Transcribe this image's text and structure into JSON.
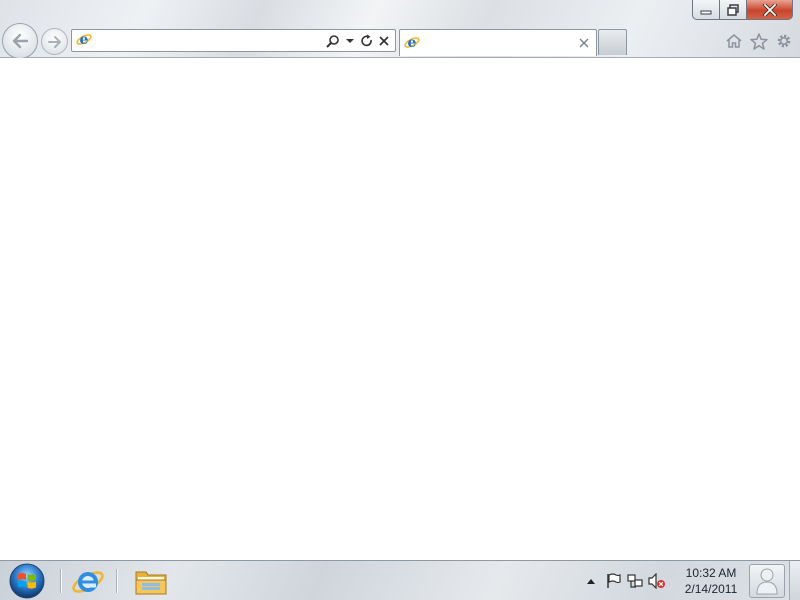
{
  "window": {
    "caption_buttons": [
      {
        "name": "minimize",
        "icon": "minimize-icon"
      },
      {
        "name": "maximize",
        "icon": "restore-icon"
      },
      {
        "name": "close",
        "icon": "close-icon"
      }
    ]
  },
  "navigation": {
    "back_icon": "back-arrow-icon",
    "forward_icon": "forward-arrow-icon"
  },
  "address_bar": {
    "value": "",
    "placeholder": "",
    "icons": [
      "ie-logo-icon",
      "search-icon",
      "dropdown-arrow-icon",
      "refresh-icon",
      "stop-icon"
    ]
  },
  "tabs": [
    {
      "title": "",
      "icon": "ie-logo-icon",
      "active": true
    }
  ],
  "command_icons": [
    "home-icon",
    "favorites-star-icon",
    "tools-gear-icon"
  ],
  "taskbar": {
    "pinned": [
      {
        "name": "internet-explorer",
        "icon": "ie-logo-icon"
      },
      {
        "name": "windows-explorer",
        "icon": "folder-icon"
      }
    ],
    "tray_icons": [
      "show-hidden-icons-arrow",
      "action-center-flag-icon",
      "network-icon",
      "volume-muted-icon"
    ],
    "clock": {
      "time": "10:32 AM",
      "date": "2/14/2011"
    }
  },
  "colors": {
    "close_button": "#c9442b",
    "ie_blue": "#1f6fc7",
    "ie_ring": "#f2b632"
  }
}
